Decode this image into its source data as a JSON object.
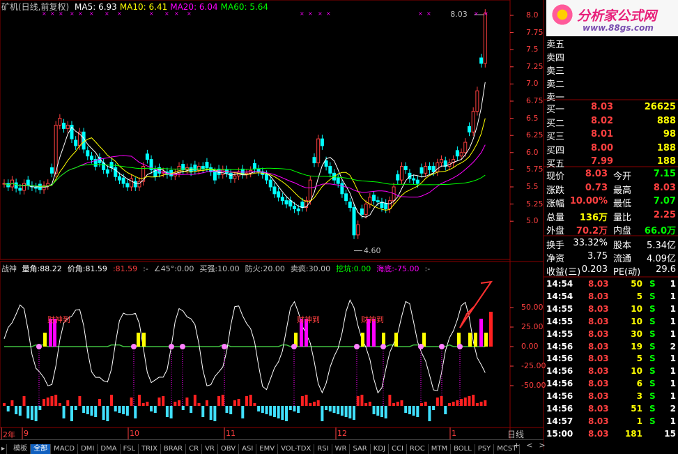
{
  "header": {
    "title": "矿机(日线,前复权)",
    "ma": [
      {
        "label": "MA5:",
        "value": "6.93",
        "color": "#ffffff"
      },
      {
        "label": "MA10:",
        "value": "6.41",
        "color": "#ffff00"
      },
      {
        "label": "MA20:",
        "value": "6.04",
        "color": "#ff00ff"
      },
      {
        "label": "MA60:",
        "value": "5.64",
        "color": "#00ff00"
      }
    ]
  },
  "main_axis": [
    "8.0",
    "7.75",
    "7.5",
    "7.25",
    "7.0",
    "6.75",
    "6.5",
    "6.25",
    "6.0",
    "5.75",
    "5.5",
    "5.25",
    "5.0"
  ],
  "high_label": "8.03",
  "low_label": "4.60",
  "indicator": {
    "name": "战神",
    "items": [
      {
        "label": "量角:",
        "value": "88.22",
        "color": "#ffffff"
      },
      {
        "label": "价角:",
        "value": "81.59",
        "color": "#ffffff"
      },
      {
        "label": ":",
        "value": "81.59",
        "color": "#ff4040"
      },
      {
        "label": ":-",
        "value": "",
        "color": "#c0c0c0"
      },
      {
        "label": "∠45°:",
        "value": "0.00",
        "color": "#c0c0c0"
      },
      {
        "label": "买强:",
        "value": "10.00",
        "color": "#c0c0c0"
      },
      {
        "label": "防火:",
        "value": "20.00",
        "color": "#c0c0c0"
      },
      {
        "label": "卖疯:",
        "value": "30.00",
        "color": "#c0c0c0"
      },
      {
        "label": "挖坑:",
        "value": "0.00",
        "color": "#00ff00"
      },
      {
        "label": "海底:",
        "value": "-75.00",
        "color": "#ff00ff"
      },
      {
        "label": ":-",
        "value": "",
        "color": "#c0c0c0"
      }
    ],
    "axis": [
      "50.00",
      "25.00",
      "0.00",
      "-25.00",
      "-50.00"
    ],
    "signal_text": "财神到"
  },
  "date_axis": [
    "2年",
    "9",
    "10",
    "11",
    "12",
    "1"
  ],
  "brand": {
    "name": "分析家公式网",
    "url": "www.88gs.com"
  },
  "order_book": {
    "asks": [
      {
        "label": "卖五",
        "price": "",
        "vol": ""
      },
      {
        "label": "卖四",
        "price": "",
        "vol": ""
      },
      {
        "label": "卖三",
        "price": "",
        "vol": ""
      },
      {
        "label": "卖二",
        "price": "",
        "vol": ""
      },
      {
        "label": "卖一",
        "price": "",
        "vol": ""
      }
    ],
    "bids": [
      {
        "label": "买一",
        "price": "8.03",
        "vol": "26625"
      },
      {
        "label": "买二",
        "price": "8.02",
        "vol": "888"
      },
      {
        "label": "买三",
        "price": "8.01",
        "vol": "98"
      },
      {
        "label": "买四",
        "price": "8.00",
        "vol": "188"
      },
      {
        "label": "买五",
        "price": "7.99",
        "vol": "188"
      }
    ]
  },
  "quote": [
    {
      "l1": "现价",
      "v1": "8.03",
      "c1": "#ff4040",
      "l2": "今开",
      "v2": "7.15",
      "c2": "#00ff00"
    },
    {
      "l1": "涨跌",
      "v1": "0.73",
      "c1": "#ff4040",
      "l2": "最高",
      "v2": "8.03",
      "c2": "#ff4040"
    },
    {
      "l1": "涨幅",
      "v1": "10.00%",
      "c1": "#ff4040",
      "l2": "最低",
      "v2": "7.07",
      "c2": "#00ff00"
    },
    {
      "l1": "总量",
      "v1": "136万",
      "c1": "#ffff00",
      "l2": "量比",
      "v2": "2.25",
      "c2": "#ff4040"
    },
    {
      "l1": "外盘",
      "v1": "70.2万",
      "c1": "#ff4040",
      "l2": "内盘",
      "v2": "66.0万",
      "c2": "#00ff00"
    }
  ],
  "fundamentals": [
    {
      "l1": "换手",
      "v1": "33.32%",
      "l2": "股本",
      "v2": "5.34亿"
    },
    {
      "l1": "净资",
      "v1": "3.75",
      "l2": "流通",
      "v2": "4.09亿"
    },
    {
      "l1": "收益(三)",
      "v1": "0.203",
      "l2": "PE(动)",
      "v2": "29.6"
    }
  ],
  "ticks": [
    {
      "time": "14:54",
      "price": "8.03",
      "vol": "50",
      "side": "S",
      "n": "1"
    },
    {
      "time": "14:54",
      "price": "8.03",
      "vol": "5",
      "side": "S",
      "n": "1"
    },
    {
      "time": "14:55",
      "price": "8.03",
      "vol": "10",
      "side": "S",
      "n": "1"
    },
    {
      "time": "14:55",
      "price": "8.03",
      "vol": "10",
      "side": "S",
      "n": "1"
    },
    {
      "time": "14:55",
      "price": "8.03",
      "vol": "30",
      "side": "S",
      "n": "1"
    },
    {
      "time": "14:56",
      "price": "8.03",
      "vol": "19",
      "side": "S",
      "n": "2"
    },
    {
      "time": "14:56",
      "price": "8.03",
      "vol": "5",
      "side": "S",
      "n": "1"
    },
    {
      "time": "14:56",
      "price": "8.03",
      "vol": "10",
      "side": "S",
      "n": "1"
    },
    {
      "time": "14:56",
      "price": "8.03",
      "vol": "6",
      "side": "S",
      "n": "1"
    },
    {
      "time": "14:56",
      "price": "8.03",
      "vol": "3",
      "side": "S",
      "n": "1"
    },
    {
      "time": "14:56",
      "price": "8.03",
      "vol": "51",
      "side": "S",
      "n": "2"
    },
    {
      "time": "14:57",
      "price": "8.03",
      "vol": "1",
      "side": "S",
      "n": "1"
    },
    {
      "time": "15:00",
      "price": "8.03",
      "vol": "181",
      "side": "",
      "n": "15"
    }
  ],
  "tabs": [
    "模板",
    "全部",
    "MACD",
    "DMI",
    "DMA",
    "FSL",
    "TRIX",
    "BRAR",
    "CR",
    "VR",
    "OBV",
    "ASI",
    "EMV",
    "VOL-TDX",
    "RSI",
    "WR",
    "SAR",
    "KDJ",
    "CCI",
    "ROC",
    "MTM",
    "BOLL",
    "PSY",
    "MCST"
  ],
  "period_label": "日线",
  "nav_buttons": [
    "-",
    "+",
    "<",
    ">"
  ]
}
